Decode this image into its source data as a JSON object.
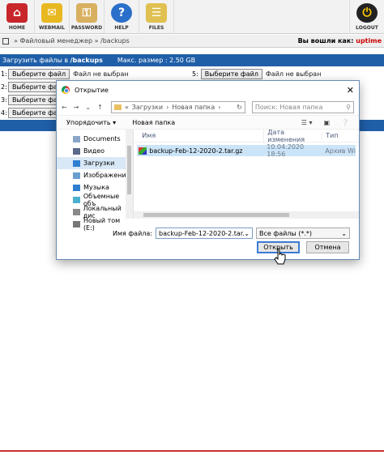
{
  "toolbar": {
    "home": "HOME",
    "webmail": "WEBMAIL",
    "password": "PASSWORD",
    "help": "HELP",
    "files": "FILES",
    "logout": "LOGOUT"
  },
  "breadcrumb": {
    "path": "» Файловый менеджер » /backups",
    "login_prefix": "Вы вошли как:",
    "user": "uptime"
  },
  "upload": {
    "title_prefix": "Загрузить файлы в",
    "folder": "/backups",
    "max_size": "Макс. размер : 2.50 GB",
    "choose": "Выберите файл",
    "none": "Файл не выбран",
    "n1": "1:",
    "n2": "2:",
    "n3": "3:",
    "n4": "4:",
    "n5": "5:"
  },
  "dialog": {
    "title": "Открытие",
    "path_prefix": "«",
    "path_1": "Загрузки",
    "path_2": "Новая папка",
    "search_placeholder": "Поиск: Новая папка",
    "organize": "Упорядочить ▾",
    "new_folder": "Новая папка",
    "nav_items": [
      {
        "label": "Documents",
        "icon": "documents-icon",
        "color": "#8aa6c8"
      },
      {
        "label": "Видео",
        "icon": "video-icon",
        "color": "#5a6a8a"
      },
      {
        "label": "Загрузки",
        "icon": "downloads-icon",
        "color": "#2f7fd0"
      },
      {
        "label": "Изображения",
        "icon": "images-icon",
        "color": "#6aa0d0"
      },
      {
        "label": "Музыка",
        "icon": "music-icon",
        "color": "#2f7fd0"
      },
      {
        "label": "Объемные объ",
        "icon": "3d-objects-icon",
        "color": "#4ab0d0"
      },
      {
        "label": "Локальный дис",
        "icon": "local-disk-icon",
        "color": "#888888"
      },
      {
        "label": "Новый том (E:)",
        "icon": "drive-icon",
        "color": "#777777"
      }
    ],
    "columns": {
      "name": "Имя",
      "date": "Дата изменения",
      "type": "Тип"
    },
    "files": [
      {
        "name": "backup-Feb-12-2020-2.tar.gz",
        "date": "10.04.2020 18:56",
        "type": "Архив Wi"
      }
    ],
    "filename_label": "Имя файла:",
    "filename_value": "backup-Feb-12-2020-2.tar.gz",
    "filetype": "Все файлы (*.*)",
    "open": "Открыть",
    "cancel": "Отмена"
  }
}
